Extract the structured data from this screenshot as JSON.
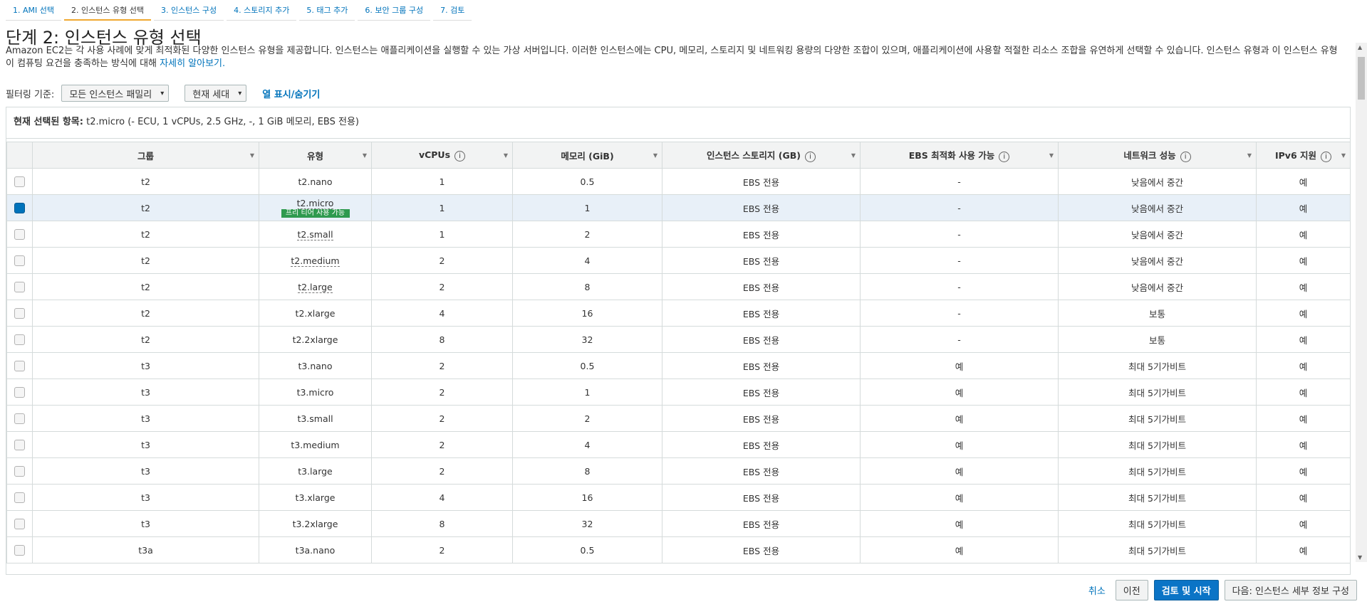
{
  "tabs": [
    {
      "label": "1. AMI 선택"
    },
    {
      "label": "2. 인스턴스 유형 선택"
    },
    {
      "label": "3. 인스턴스 구성"
    },
    {
      "label": "4. 스토리지 추가"
    },
    {
      "label": "5. 태그 추가"
    },
    {
      "label": "6. 보안 그룹 구성"
    },
    {
      "label": "7. 검토"
    }
  ],
  "title": "단계 2: 인스턴스 유형 선택",
  "description": "Amazon EC2는 각 사용 사례에 맞게 최적화된 다양한 인스턴스 유형을 제공합니다. 인스턴스는 애플리케이션을 실행할 수 있는 가상 서버입니다. 이러한 인스턴스에는 CPU, 메모리, 스토리지 및 네트워킹 용량의 다양한 조합이 있으며, 애플리케이션에 사용할 적절한 리소스 조합을 유연하게 선택할 수 있습니다. 인스턴스 유형과 이 인스턴스 유형이 컴퓨팅 요건을 충족하는 방식에 대해 ",
  "description_link": "자세히 알아보기.",
  "filter": {
    "label": "필터링 기준:",
    "family": "모든 인스턴스 패밀리",
    "generation": "현재 세대",
    "columns_link": "열 표시/숨기기"
  },
  "selected": {
    "label": "현재 선택된 항목:",
    "value": "t2.micro (- ECU, 1 vCPUs, 2.5 GHz, -, 1 GiB 메모리, EBS 전용)"
  },
  "columns": [
    "그룹",
    "유형",
    "vCPUs",
    "메모리 (GiB)",
    "인스턴스 스토리지 (GB)",
    "EBS 최적화 사용 가능",
    "네트워크 성능",
    "IPv6 지원"
  ],
  "free_tier_badge": "프리 티어 사용 가능",
  "rows": [
    [
      "t2",
      "t2.nano",
      "1",
      "0.5",
      "EBS 전용",
      "-",
      "낮음에서 중간",
      "예"
    ],
    [
      "t2",
      "t2.micro",
      "1",
      "1",
      "EBS 전용",
      "-",
      "낮음에서 중간",
      "예"
    ],
    [
      "t2",
      "t2.small",
      "1",
      "2",
      "EBS 전용",
      "-",
      "낮음에서 중간",
      "예"
    ],
    [
      "t2",
      "t2.medium",
      "2",
      "4",
      "EBS 전용",
      "-",
      "낮음에서 중간",
      "예"
    ],
    [
      "t2",
      "t2.large",
      "2",
      "8",
      "EBS 전용",
      "-",
      "낮음에서 중간",
      "예"
    ],
    [
      "t2",
      "t2.xlarge",
      "4",
      "16",
      "EBS 전용",
      "-",
      "보통",
      "예"
    ],
    [
      "t2",
      "t2.2xlarge",
      "8",
      "32",
      "EBS 전용",
      "-",
      "보통",
      "예"
    ],
    [
      "t3",
      "t3.nano",
      "2",
      "0.5",
      "EBS 전용",
      "예",
      "최대 5기가비트",
      "예"
    ],
    [
      "t3",
      "t3.micro",
      "2",
      "1",
      "EBS 전용",
      "예",
      "최대 5기가비트",
      "예"
    ],
    [
      "t3",
      "t3.small",
      "2",
      "2",
      "EBS 전용",
      "예",
      "최대 5기가비트",
      "예"
    ],
    [
      "t3",
      "t3.medium",
      "2",
      "4",
      "EBS 전용",
      "예",
      "최대 5기가비트",
      "예"
    ],
    [
      "t3",
      "t3.large",
      "2",
      "8",
      "EBS 전용",
      "예",
      "최대 5기가비트",
      "예"
    ],
    [
      "t3",
      "t3.xlarge",
      "4",
      "16",
      "EBS 전용",
      "예",
      "최대 5기가비트",
      "예"
    ],
    [
      "t3",
      "t3.2xlarge",
      "8",
      "32",
      "EBS 전용",
      "예",
      "최대 5기가비트",
      "예"
    ],
    [
      "t3a",
      "t3a.nano",
      "2",
      "0.5",
      "EBS 전용",
      "예",
      "최대 5기가비트",
      "예"
    ]
  ],
  "footer": {
    "cancel": "취소",
    "previous": "이전",
    "review_launch": "검토 및 시작",
    "next": "다음: 인스턴스 세부 정보 구성"
  }
}
